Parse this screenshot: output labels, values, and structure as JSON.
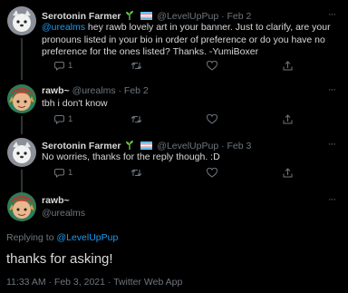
{
  "colors": {
    "background": "#000000",
    "accent": "#1d9bf0",
    "text": "#d9d9d9",
    "muted": "#6e767d",
    "border": "#2f3336"
  },
  "tweets": [
    {
      "name": "Serotonin Farmer",
      "handle": "@LevelUpPup",
      "sep": "·",
      "date": "Feb 2",
      "mention": "@urealms",
      "text": " hey rawb lovely art in your banner. Just to clarify, are your pronouns listed in your bio in order of preference or do you have no preference for the ones listed? Thanks. -YumiBoxer",
      "reply_count": "1"
    },
    {
      "name": "rawb~",
      "handle": "@urealms",
      "sep": "·",
      "date": "Feb 2",
      "text": "tbh i don't know",
      "reply_count": "1"
    },
    {
      "name": "Serotonin Farmer",
      "handle": "@LevelUpPup",
      "sep": "·",
      "date": "Feb 3",
      "text": "No worries, thanks for the reply though. :D",
      "reply_count": "1"
    }
  ],
  "focus": {
    "name": "rawb~",
    "handle": "@urealms",
    "replying_prefix": "Replying to ",
    "replying_to": "@LevelUpPup",
    "text": "thanks for asking!",
    "timestamp": "11:33 AM · Feb 3, 2021 · Twitter Web App"
  },
  "icons": [
    "reply-icon",
    "retweet-icon",
    "like-icon",
    "share-icon",
    "more-icon",
    "seedling-icon",
    "flag-icon"
  ]
}
